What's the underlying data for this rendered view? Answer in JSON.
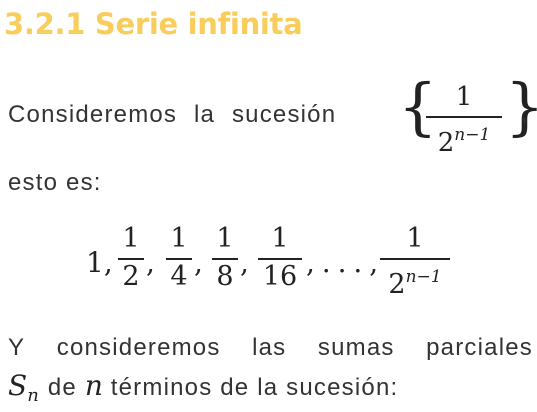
{
  "heading": {
    "text": "3.2.1 Serie infinita",
    "color": "#f9cd5b"
  },
  "paragraph1": {
    "lead": "Consideremos la sucesión",
    "trailing_comma": ",",
    "continuation": "esto es:"
  },
  "sequence_term": {
    "numerator": "1",
    "denominator_base": "2",
    "denominator_exponent": "n−1"
  },
  "series": {
    "first": "1,",
    "fractions": [
      {
        "numerator": "1",
        "denominator": "2",
        "separator": ","
      },
      {
        "numerator": "1",
        "denominator": "4",
        "separator": ","
      },
      {
        "numerator": "1",
        "denominator": "8",
        "separator": ","
      },
      {
        "numerator": "1",
        "denominator": "16",
        "separator": ", . . . ,"
      }
    ],
    "last": {
      "numerator": "1",
      "denominator_base": "2",
      "denominator_exponent": "n−1"
    }
  },
  "paragraph2": {
    "words": [
      "Y",
      "consideremos",
      "las",
      "sumas",
      "parciales"
    ],
    "var_S": "S",
    "var_S_sub": "n",
    "de": "de",
    "var_n": "n",
    "rest": "términos de la sucesión:"
  }
}
